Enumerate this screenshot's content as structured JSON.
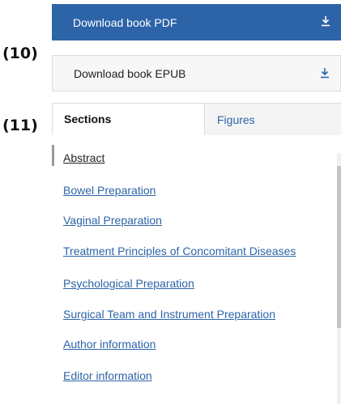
{
  "annotations": {
    "first": "(10)",
    "second": "(11)"
  },
  "downloads": {
    "pdf_label": "Download book PDF",
    "epub_label": "Download book EPUB"
  },
  "tabs": [
    {
      "label": "Sections",
      "active": true
    },
    {
      "label": "Figures",
      "active": false
    }
  ],
  "sections": [
    "Abstract",
    "Bowel Preparation",
    "Vaginal Preparation",
    "Treatment Principles of Concomitant Diseases",
    "Psychological Preparation",
    "Surgical Team and Instrument Preparation",
    "Author information",
    "Editor information"
  ],
  "colors": {
    "accent": "#2d64a8",
    "tab_inactive_bg": "#f4f4f4"
  },
  "icons": {
    "download": "download-icon"
  }
}
